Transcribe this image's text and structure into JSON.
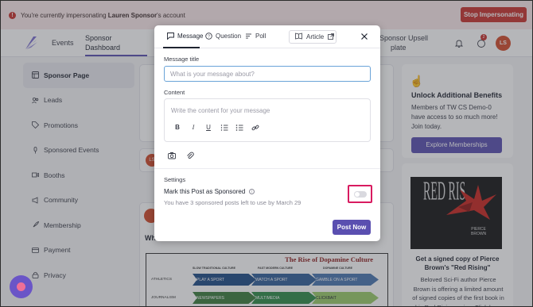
{
  "banner": {
    "prefix": "You're currently impersonating ",
    "name": "Lauren Sponsor",
    "suffix": "'s account",
    "stop_label": "Stop Impersonating"
  },
  "nav": {
    "events": "Events",
    "sponsor_line1": "Sponsor",
    "sponsor_line2": "Dashboard",
    "upsell_line1": "Sponsor Upsell",
    "upsell_line2": "plate",
    "badge_count": "2",
    "avatar_initials": "LS"
  },
  "sidebar": {
    "items": [
      {
        "label": "Sponsor Page",
        "icon": "page-icon"
      },
      {
        "label": "Leads",
        "icon": "users-icon"
      },
      {
        "label": "Promotions",
        "icon": "tag-icon"
      },
      {
        "label": "Sponsored Events",
        "icon": "mic-icon"
      },
      {
        "label": "Booths",
        "icon": "video-icon"
      },
      {
        "label": "Community",
        "icon": "megaphone-icon"
      },
      {
        "label": "Membership",
        "icon": "rocket-icon"
      },
      {
        "label": "Payment",
        "icon": "card-icon"
      },
      {
        "label": "Privacy",
        "icon": "lock-icon"
      }
    ]
  },
  "center": {
    "avatar_initials": "LS",
    "heading_fragment": "Wh",
    "infographic": {
      "title": "The Rise of Dopamine Culture",
      "headers": [
        "SLOW TRADITIONAL CULTURE",
        "FAST MODERN CULTURE",
        "DOPAMINE CULTURE"
      ],
      "rows": [
        {
          "label": "ATHLETICS",
          "cells": [
            "PLAY A SPORT",
            "WATCH A SPORT",
            "GAMBLE ON A SPORT"
          ]
        },
        {
          "label": "JOURNALISM",
          "cells": [
            "NEWSPAPERS",
            "MULTIMEDIA",
            "CLICKBAIT"
          ]
        }
      ]
    }
  },
  "right": {
    "benefits_title": "Unlock Additional Benefits",
    "benefits_desc": "Members of TW CS Demo-0 have access to so much more! Join today.",
    "explore_label": "Explore Memberships",
    "book_cover_title": "RED RIS",
    "book_cover_author_1": "PIERCE",
    "book_cover_author_2": "BROWN",
    "book_title": "Get a signed copy of Pierce Brown's \"Red Rising\"",
    "book_desc": "Beloved Sci-Fi author Pierce Brown is offering a limited amount of signed copies of the first book in his Red Rising series. Click here to"
  },
  "modal": {
    "tabs": [
      {
        "label": "Message"
      },
      {
        "label": "Question"
      },
      {
        "label": "Poll"
      }
    ],
    "article_label": "Article",
    "message_title_label": "Message title",
    "message_title_placeholder": "What is your message about?",
    "content_label": "Content",
    "content_placeholder": "Write the content for your message",
    "format_buttons": [
      "B",
      "I",
      "U"
    ],
    "settings_label": "Settings",
    "mark_sponsored_label": "Mark this Post as Sponsored",
    "remaining_text": "You have 3 sponsored posts left to use by March 29",
    "post_label": "Post Now"
  },
  "colors": {
    "accent": "#5a4fb0",
    "danger": "#c8322e",
    "highlight": "#d81b60"
  }
}
